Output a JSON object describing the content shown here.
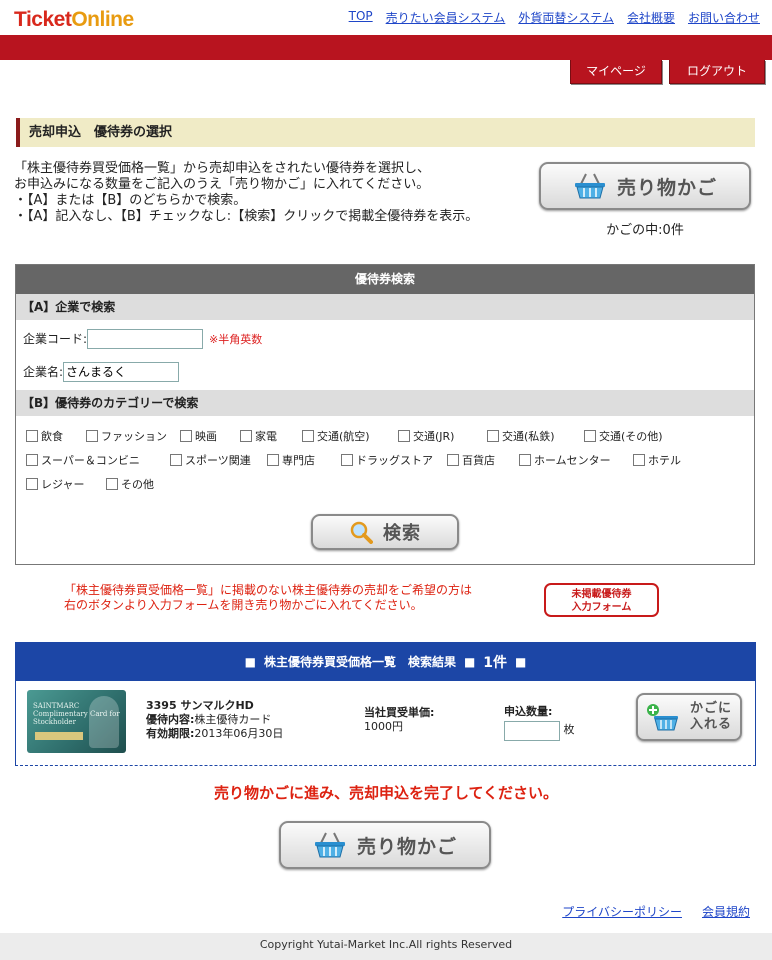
{
  "header": {
    "logo_part1": "Ticket",
    "logo_part2": "Online",
    "nav": [
      "TOP",
      "売りたい会員システム",
      "外貨両替システム",
      "会社概要",
      "お問い合わせ"
    ],
    "mypage_label": "マイページ",
    "logout_label": "ログアウト"
  },
  "page_title": "売却申込　優待券の選択",
  "instructions": [
    "「株主優待券買受価格一覧」から売却申込をされたい優待券を選択し、",
    "お申込みになる数量をご記入のうえ「売り物かご」に入れてください。",
    "・【A】または【B】のどちらかで検索。",
    "・【A】記入なし、【B】チェックなし:【検索】クリックで掲載全優待券を表示。"
  ],
  "cart": {
    "button_label": "売り物かご",
    "count_text": "かごの中:0件"
  },
  "search": {
    "title": "優待券検索",
    "section_a": "【A】企業で検索",
    "code_label": "企業コード:",
    "code_value": "",
    "code_note": "※半角英数",
    "name_label": "企業名:",
    "name_value": "さんまるく",
    "section_b": "【B】優待券のカテゴリーで検索",
    "categories_row1": [
      "飲食",
      "ファッション",
      "映画",
      "家電",
      "交通(航空)",
      "交通(JR)",
      "交通(私鉄)",
      "交通(その他)"
    ],
    "categories_row2": [
      "スーパー＆コンビニ",
      "スポーツ関連",
      "専門店",
      "ドラッグストア",
      "百貨店",
      "ホームセンター",
      "ホテル"
    ],
    "categories_row3": [
      "レジャー",
      "その他"
    ],
    "search_button": "検索"
  },
  "unlisted": {
    "line1": "「株主優待券買受価格一覧」に掲載のない株主優待券の売却をご希望の方は",
    "line2": "右のボタンより入力フォームを開き売り物かごに入れてください。",
    "button_line1": "未掲載優待券",
    "button_line2": "入力フォーム"
  },
  "results": {
    "heading": "株主優待券買受価格一覧　検索結果",
    "count": "1件",
    "items": [
      {
        "name": "3395 サンマルクHD",
        "content_label": "優待内容:",
        "content_value": "株主優待カード",
        "expiry_label": "有効期限:",
        "expiry_value": "2013年06月30日",
        "price_label": "当社買受単価:",
        "price_value": "1000円",
        "qty_label": "申込数量:",
        "qty_value": "",
        "qty_unit": "枚",
        "add_line1": "かごに",
        "add_line2": "入れる",
        "image_text": "SAINTMARC Complimentary Card for Stockholder"
      }
    ]
  },
  "complete_message": "売り物かごに進み、売却申込を完了してください。",
  "footer": {
    "links": [
      "プライバシーポリシー",
      "会員規約"
    ],
    "copyright": "Copyright Yutai-Market Inc.All rights Reserved"
  },
  "colors": {
    "brand_red": "#b8141f",
    "result_blue": "#1c46a6",
    "link_blue": "#1f46c8"
  }
}
